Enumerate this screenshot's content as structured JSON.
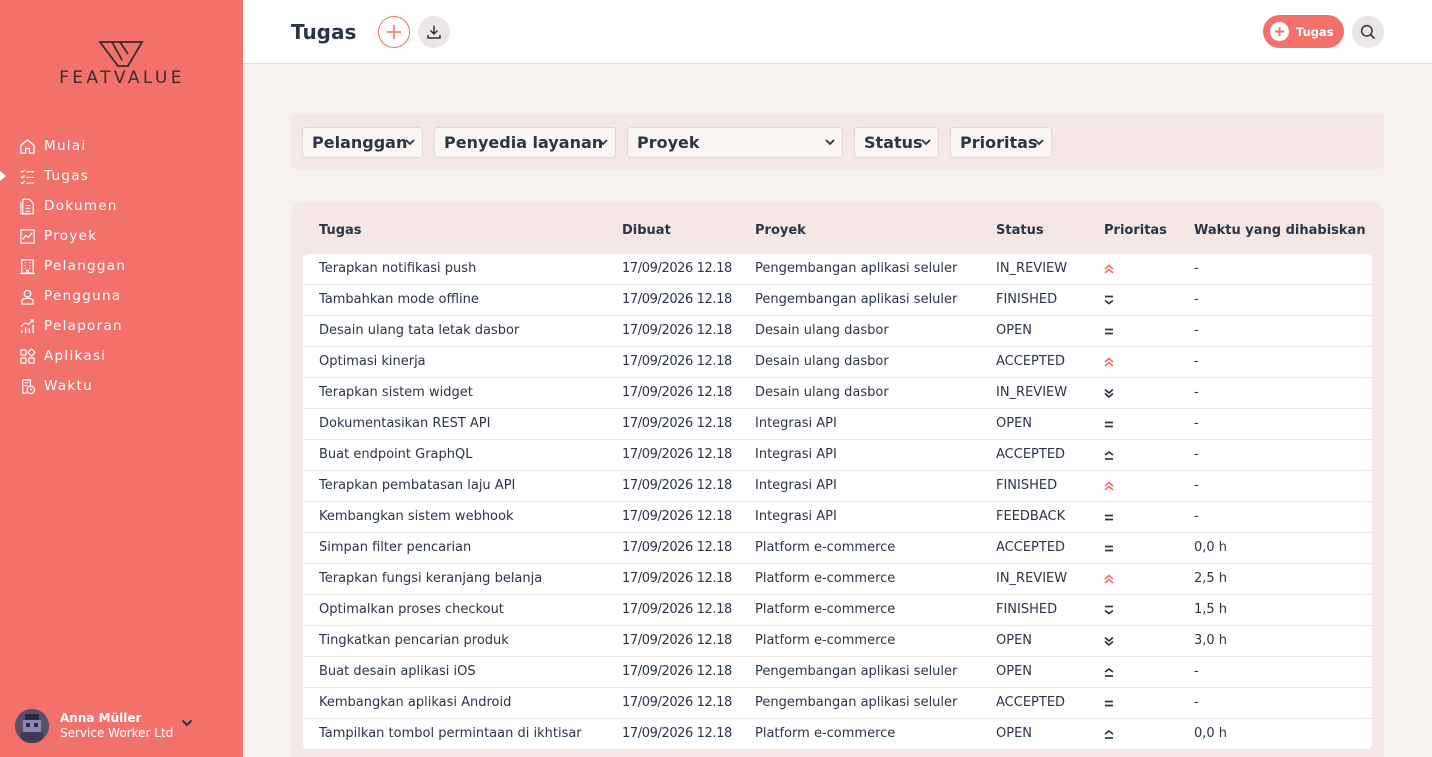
{
  "brand": {
    "logo_text": "FEATVALUE",
    "accent": "#f3716b"
  },
  "sidebar": {
    "items": [
      {
        "label": "Mulai",
        "icon": "home-icon"
      },
      {
        "label": "Tugas",
        "icon": "checklist-icon",
        "active": true
      },
      {
        "label": "Dokumen",
        "icon": "document-icon"
      },
      {
        "label": "Proyek",
        "icon": "project-chart-icon"
      },
      {
        "label": "Pelanggan",
        "icon": "building-icon"
      },
      {
        "label": "Pengguna",
        "icon": "user-icon"
      },
      {
        "label": "Pelaporan",
        "icon": "reporting-icon"
      },
      {
        "label": "Aplikasi",
        "icon": "apps-icon"
      },
      {
        "label": "Waktu",
        "icon": "time-icon"
      }
    ]
  },
  "user": {
    "name": "Anna Müller",
    "company": "Service Worker Ltd"
  },
  "header": {
    "title": "Tugas",
    "new_task_label": "Tugas"
  },
  "filters": [
    {
      "label": "Pelanggan"
    },
    {
      "label": "Penyedia layanan"
    },
    {
      "label": "Proyek"
    },
    {
      "label": "Status"
    },
    {
      "label": "Prioritas"
    }
  ],
  "table": {
    "columns": [
      "Tugas",
      "Dibuat",
      "Proyek",
      "Status",
      "Prioritas",
      "Waktu yang dihabiskan"
    ],
    "rows": [
      {
        "task": "Terapkan notifikasi push",
        "created": "17/09/2026 12.18",
        "project": "Pengembangan aplikasi seluler",
        "status": "IN_REVIEW",
        "priority": "highest",
        "time": "-"
      },
      {
        "task": "Tambahkan mode offline",
        "created": "17/09/2026 12.18",
        "project": "Pengembangan aplikasi seluler",
        "status": "FINISHED",
        "priority": "low",
        "time": "-"
      },
      {
        "task": "Desain ulang tata letak dasbor",
        "created": "17/09/2026 12.18",
        "project": "Desain ulang dasbor",
        "status": "OPEN",
        "priority": "medium",
        "time": "-"
      },
      {
        "task": "Optimasi kinerja",
        "created": "17/09/2026 12.18",
        "project": "Desain ulang dasbor",
        "status": "ACCEPTED",
        "priority": "highest",
        "time": "-"
      },
      {
        "task": "Terapkan sistem widget",
        "created": "17/09/2026 12.18",
        "project": "Desain ulang dasbor",
        "status": "IN_REVIEW",
        "priority": "lowest",
        "time": "-"
      },
      {
        "task": "Dokumentasikan REST API",
        "created": "17/09/2026 12.18",
        "project": "Integrasi API",
        "status": "OPEN",
        "priority": "medium",
        "time": "-"
      },
      {
        "task": "Buat endpoint GraphQL",
        "created": "17/09/2026 12.18",
        "project": "Integrasi API",
        "status": "ACCEPTED",
        "priority": "high",
        "time": "-"
      },
      {
        "task": "Terapkan pembatasan laju API",
        "created": "17/09/2026 12.18",
        "project": "Integrasi API",
        "status": "FINISHED",
        "priority": "highest",
        "time": "-"
      },
      {
        "task": "Kembangkan sistem webhook",
        "created": "17/09/2026 12.18",
        "project": "Integrasi API",
        "status": "FEEDBACK",
        "priority": "medium",
        "time": "-"
      },
      {
        "task": "Simpan filter pencarian",
        "created": "17/09/2026 12.18",
        "project": "Platform e-commerce",
        "status": "ACCEPTED",
        "priority": "medium",
        "time": "0,0 h"
      },
      {
        "task": "Terapkan fungsi keranjang belanja",
        "created": "17/09/2026 12.18",
        "project": "Platform e-commerce",
        "status": "IN_REVIEW",
        "priority": "highest",
        "time": "2,5 h"
      },
      {
        "task": "Optimalkan proses checkout",
        "created": "17/09/2026 12.18",
        "project": "Platform e-commerce",
        "status": "FINISHED",
        "priority": "low",
        "time": "1,5 h"
      },
      {
        "task": "Tingkatkan pencarian produk",
        "created": "17/09/2026 12.18",
        "project": "Platform e-commerce",
        "status": "OPEN",
        "priority": "lowest",
        "time": "3,0 h"
      },
      {
        "task": "Buat desain aplikasi iOS",
        "created": "17/09/2026 12.18",
        "project": "Pengembangan aplikasi seluler",
        "status": "OPEN",
        "priority": "high",
        "time": "-"
      },
      {
        "task": "Kembangkan aplikasi Android",
        "created": "17/09/2026 12.18",
        "project": "Pengembangan aplikasi seluler",
        "status": "ACCEPTED",
        "priority": "medium",
        "time": "-"
      },
      {
        "task": "Tampilkan tombol permintaan di ikhtisar",
        "created": "17/09/2026 12.18",
        "project": "Platform e-commerce",
        "status": "OPEN",
        "priority": "high",
        "time": "0,0 h"
      }
    ]
  }
}
